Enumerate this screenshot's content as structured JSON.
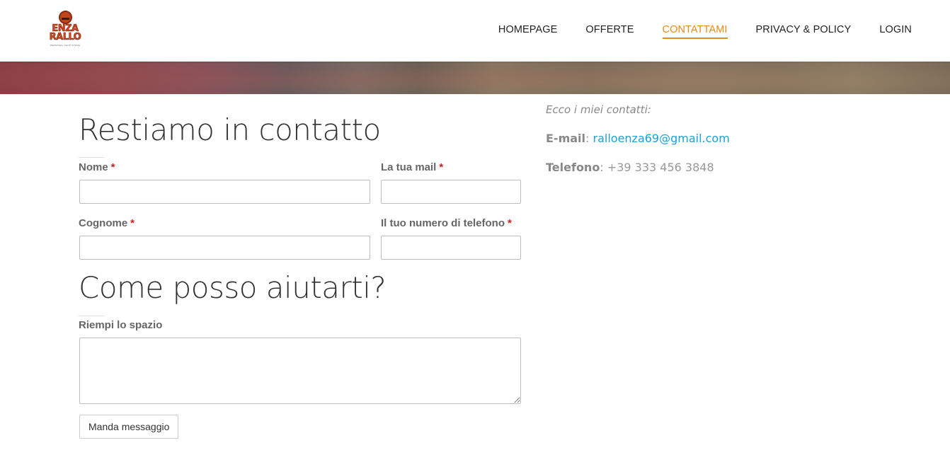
{
  "logo": {
    "line1": "ENZA",
    "line2": "RALLO",
    "tagline": "PERSONAL SHOP STORE"
  },
  "nav": {
    "items": [
      {
        "label": "HOMEPAGE",
        "active": false
      },
      {
        "label": "OFFERTE",
        "active": false
      },
      {
        "label": "CONTATTAMI",
        "active": true
      },
      {
        "label": "PRIVACY & POLICY",
        "active": false
      },
      {
        "label": "LOGIN",
        "active": false
      }
    ],
    "active_color": "#e8891a"
  },
  "form": {
    "title": "Restiamo in contatto",
    "required_mark": "*",
    "fields": {
      "nome": {
        "label": "Nome",
        "value": ""
      },
      "email": {
        "label": "La tua mail",
        "value": ""
      },
      "cognome": {
        "label": "Cognome",
        "value": ""
      },
      "telefono": {
        "label": "Il tuo numero di telefono",
        "value": ""
      }
    },
    "help_title": "Come posso aiutarti?",
    "message": {
      "label": "Riempi lo spazio",
      "value": ""
    },
    "submit_label": "Manda messaggio"
  },
  "contacts": {
    "intro": "Ecco i miei contatti:",
    "email_label": "E-mail",
    "email_value": "ralloenza69@gmail.com",
    "phone_label": "Telefono",
    "phone_value": "+39 333 456 3848",
    "separator": ":",
    "link_color": "#1aa1d8"
  }
}
